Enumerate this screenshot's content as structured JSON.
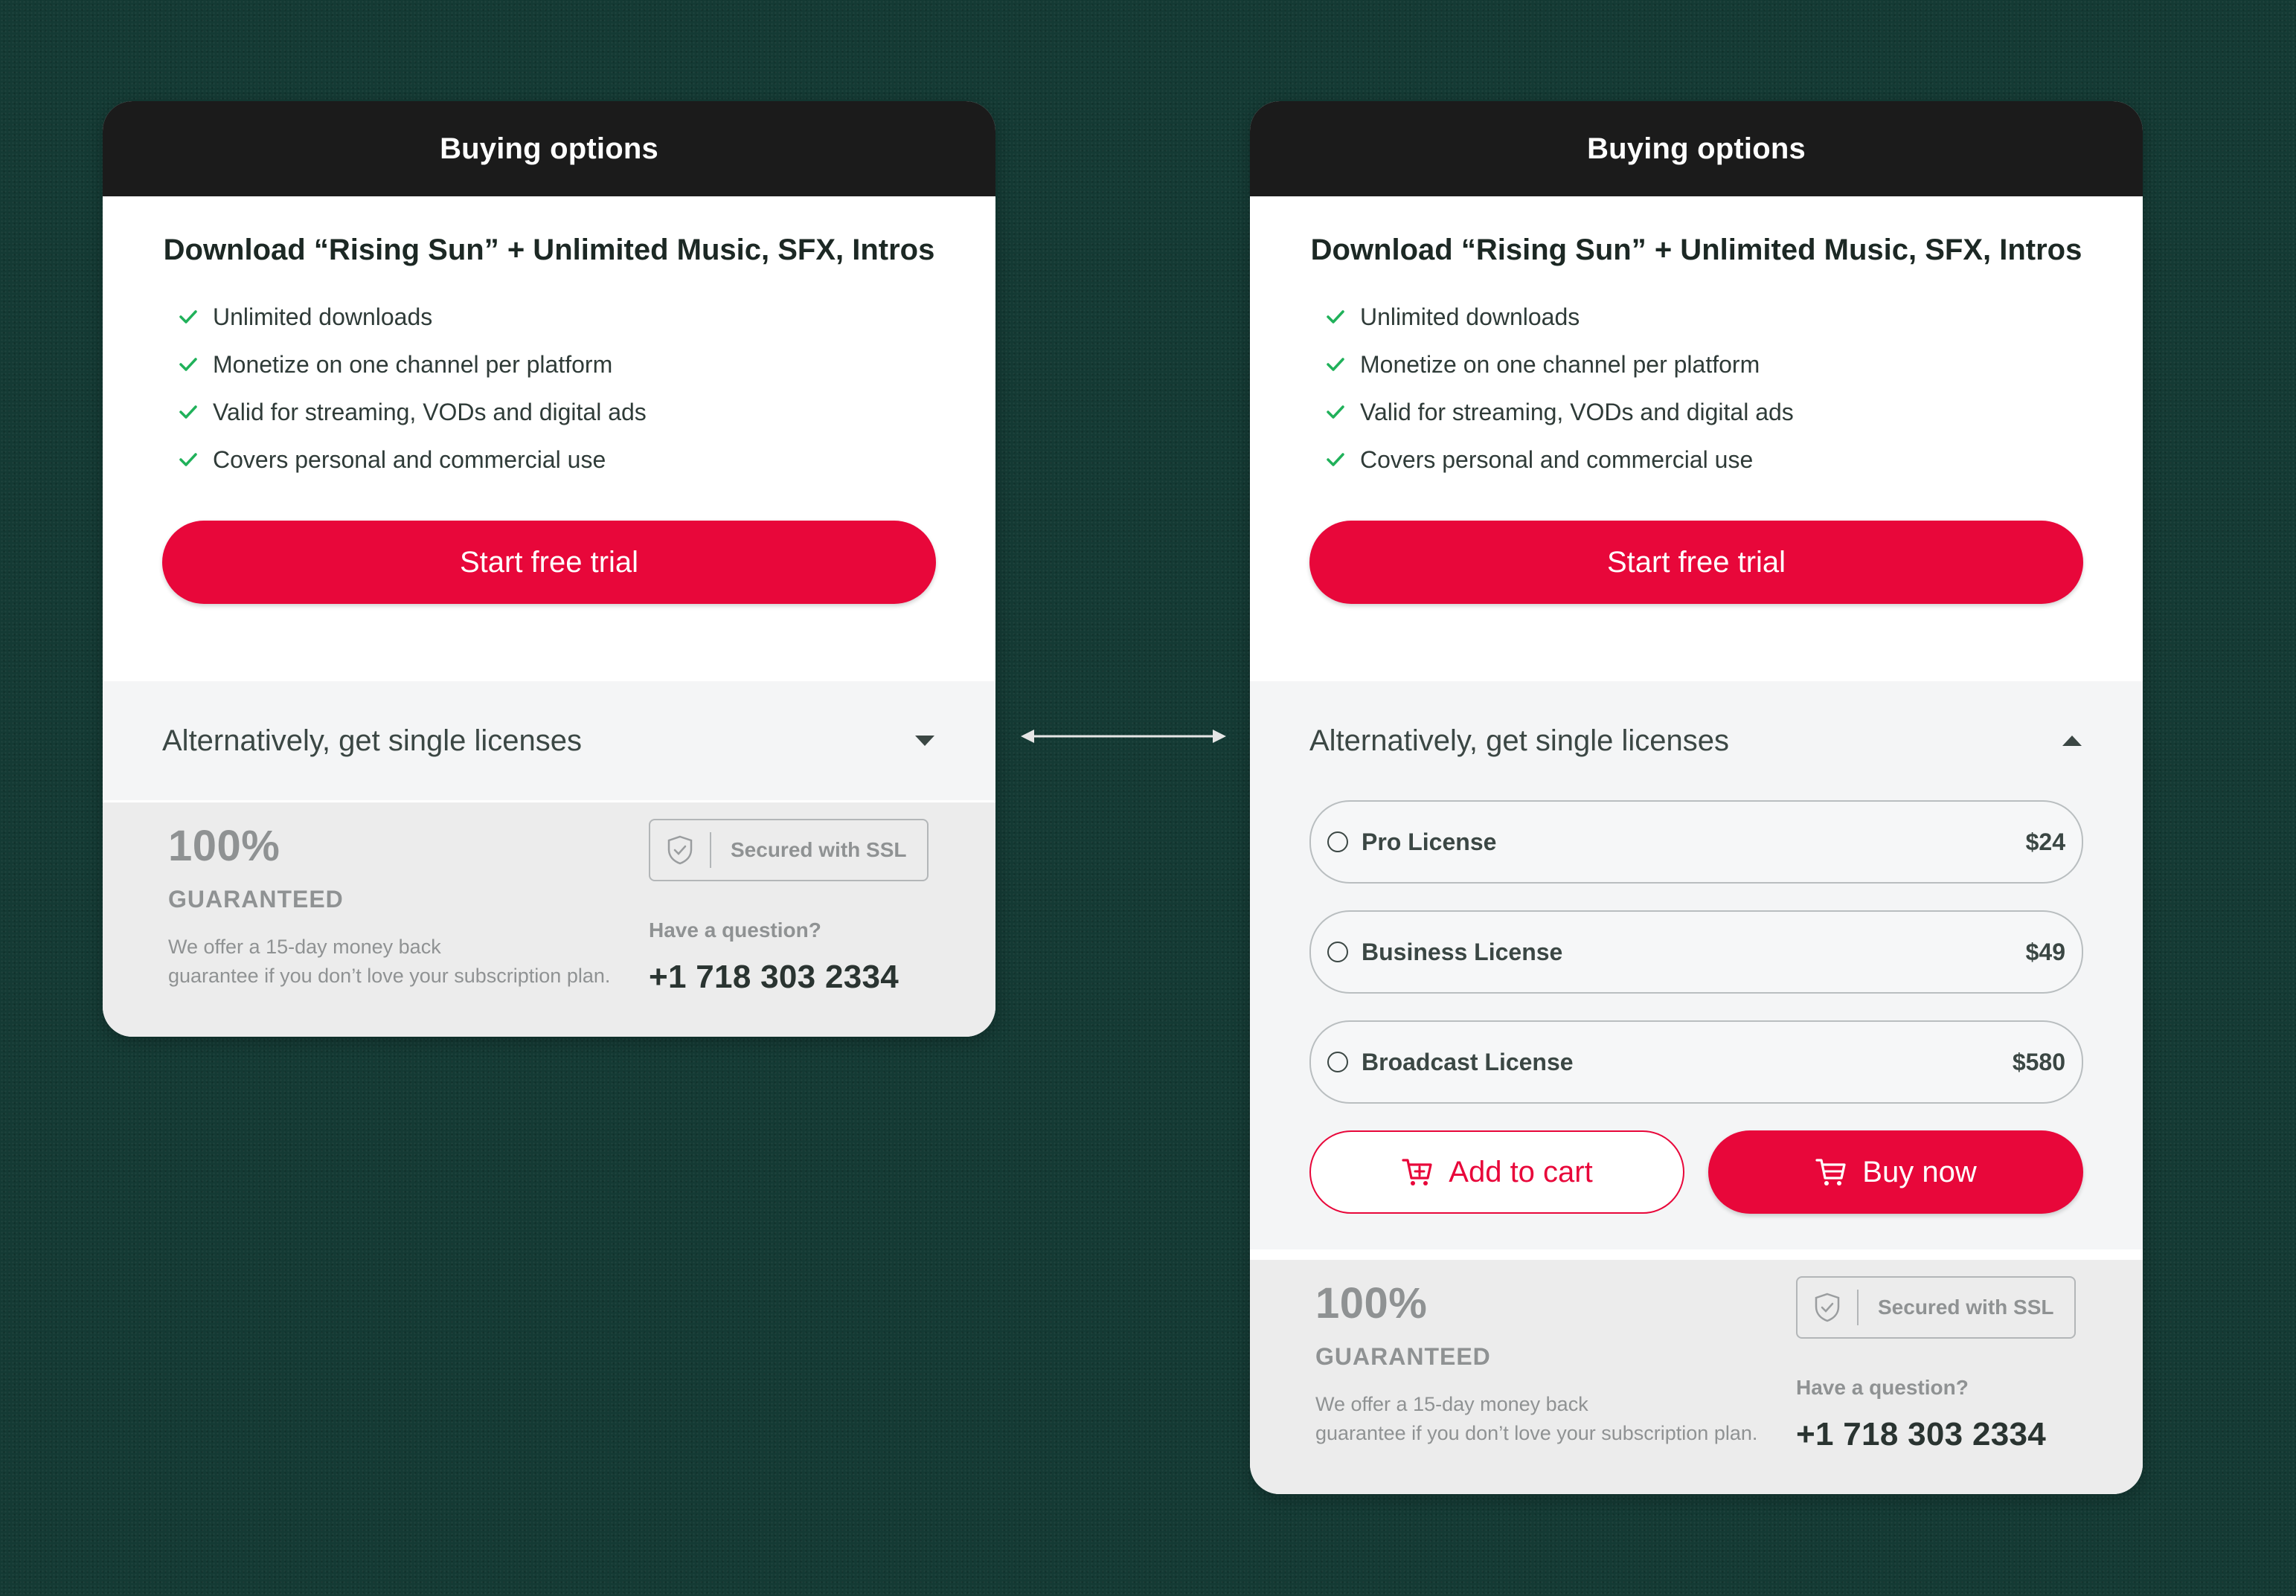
{
  "colors": {
    "background": "#143a34",
    "header": "#1b1b1b",
    "accent": "#e8073a",
    "check": "#20b15a"
  },
  "header_title": "Buying options",
  "plan": {
    "title": "Download “Rising Sun” + Unlimited Music, SFX, Intros",
    "features": [
      "Unlimited downloads",
      "Monetize on one channel per platform",
      "Valid for streaming, VODs and digital ads",
      "Covers personal and commercial use"
    ],
    "cta_label": "Start free trial"
  },
  "alternative_label": "Alternatively, get single licenses",
  "licenses": [
    {
      "name": "Pro License",
      "price": "$24"
    },
    {
      "name": "Business License",
      "price": "$49"
    },
    {
      "name": "Broadcast License",
      "price": "$580"
    }
  ],
  "actions": {
    "add_to_cart": "Add to cart",
    "buy_now": "Buy now"
  },
  "footer": {
    "guarantee_big": "100%",
    "guarantee_label": "GUARANTEED",
    "guarantee_text_line1": "We offer a 15-day money back",
    "guarantee_text_line2": "guarantee if you don’t love your subscription plan.",
    "ssl_text": "Secured with SSL",
    "question": "Have a question?",
    "phone": "+1 718 303 2334"
  },
  "icons": [
    "check-icon",
    "chevron-down-icon",
    "chevron-up-icon",
    "radio-icon",
    "cart-add-icon",
    "cart-icon",
    "shield-icon",
    "double-arrow-icon"
  ]
}
